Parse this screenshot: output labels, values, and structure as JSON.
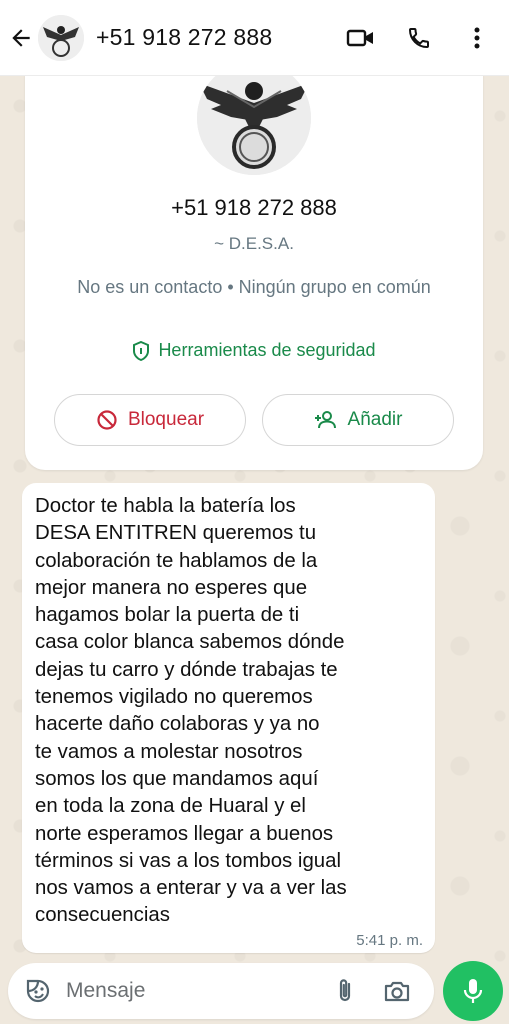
{
  "header": {
    "contact_title": "+51 918 272 888",
    "icons": [
      "back-arrow-icon",
      "video-call-icon",
      "voice-call-icon",
      "more-options-icon"
    ]
  },
  "contact_card": {
    "phone": "+51 918 272 888",
    "push_name": "~ D.E.S.A.",
    "not_contact_text": "No es un contacto • Ningún grupo en común",
    "security_label": "Herramientas de seguridad",
    "block_label": "Bloquear",
    "add_label": "Añadir"
  },
  "message": {
    "text": "Doctor te habla la batería los\nDESA ENTITREN queremos tu\ncolaboración te hablamos de la\nmejor manera no esperes que\nhagamos bolar la puerta de ti\ncasa color blanca sabemos dónde\ndejas tu carro y dónde trabajas te\ntenemos vigilado no queremos\nhacerte daño colaboras y ya no\nte vamos a molestar nosotros\nsomos los que mandamos aquí\nen toda la zona de Huaral y el\nnorte esperamos llegar a buenos\ntérminos si vas a los tombos igual\nnos vamos a enterar y va a ver las\nconsecuencias",
    "time": "5:41 p. m."
  },
  "composer": {
    "placeholder": "Mensaje"
  },
  "colors": {
    "accent_green": "#21c063",
    "security_green": "#1a8a4a",
    "block_red": "#c8283a",
    "bubble_bg": "#ffffff",
    "chat_bg": "#efe8dd"
  }
}
